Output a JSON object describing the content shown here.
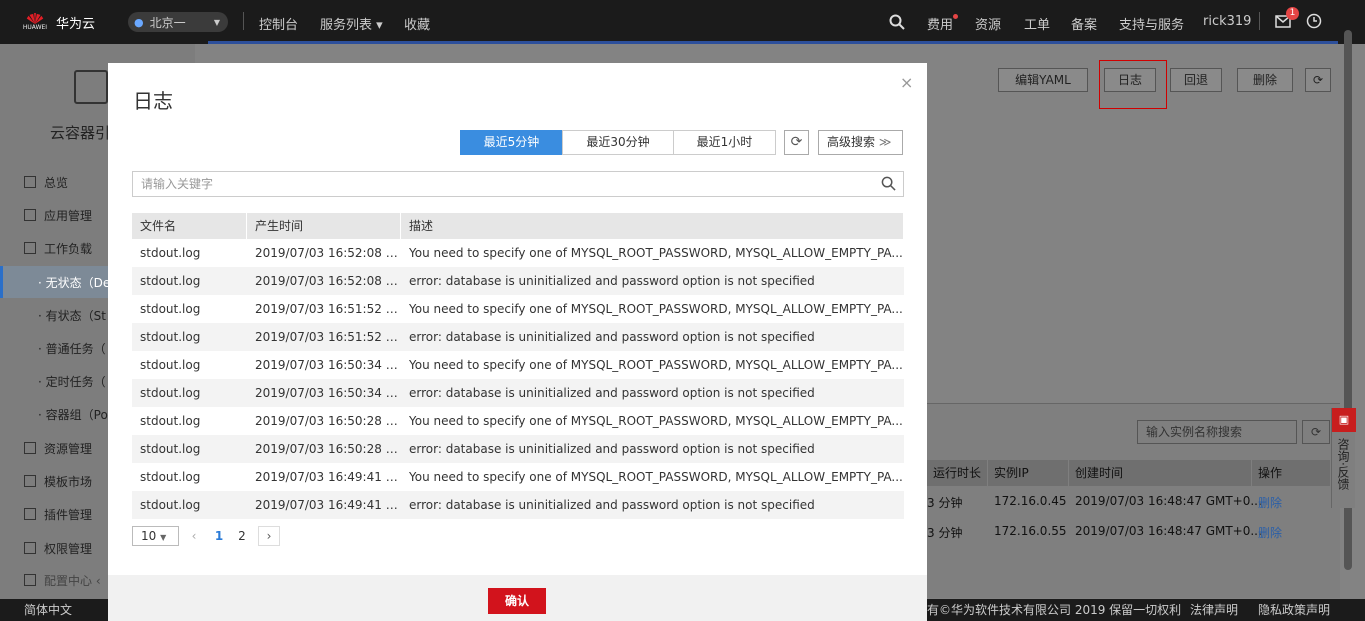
{
  "topbar": {
    "brand": "华为云",
    "brand_sub": "HUAWEI",
    "region": "北京一",
    "nav": [
      "控制台",
      "服务列表",
      "收藏"
    ],
    "right": [
      "费用",
      "资源",
      "工单",
      "备案",
      "支持与服务",
      "rick319"
    ],
    "msg_count": "1"
  },
  "sidebar": {
    "title": "云容器引",
    "items": [
      "总览",
      "应用管理",
      "工作负载"
    ],
    "subitems": [
      "无状态（De",
      "有状态（St",
      "普通任务（",
      "定时任务（",
      "容器组（Po"
    ],
    "items2": [
      "资源管理",
      "模板市场",
      "插件管理",
      "权限管理",
      "配置中心"
    ]
  },
  "background": {
    "buttons": [
      "编辑YAML",
      "日志",
      "回退",
      "删除"
    ],
    "search_placeholder": "输入实例名称搜索",
    "headers": [
      "运行时长",
      "实例IP",
      "创建时间",
      "操作"
    ],
    "rows": [
      {
        "runtime": "3 分钟",
        "ip": "172.16.0.45",
        "created": "2019/07/03 16:48:47 GMT+0...",
        "op": "删除"
      },
      {
        "runtime": "3 分钟",
        "ip": "172.16.0.55",
        "created": "2019/07/03 16:48:47 GMT+0...",
        "op": "删除"
      }
    ]
  },
  "feedback": "咨询·反馈",
  "footer": {
    "lang": "简体中文",
    "copyright": "有©华为软件技术有限公司 2019 保留一切权利",
    "legal": "法律声明",
    "privacy": "隐私政策声明"
  },
  "modal": {
    "title": "日志",
    "close": "×",
    "ranges": [
      "最近5分钟",
      "最近30分钟",
      "最近1小时"
    ],
    "advanced": "高级搜索",
    "search_placeholder": "请输入关键字",
    "headers": [
      "文件名",
      "产生时间",
      "描述"
    ],
    "rows": [
      [
        "stdout.log",
        "2019/07/03 16:52:08 G...",
        "You need to specify one of MYSQL_ROOT_PASSWORD, MYSQL_ALLOW_EMPTY_PA..."
      ],
      [
        "stdout.log",
        "2019/07/03 16:52:08 G...",
        "error: database is uninitialized and password option is not specified"
      ],
      [
        "stdout.log",
        "2019/07/03 16:51:52 G...",
        "You need to specify one of MYSQL_ROOT_PASSWORD, MYSQL_ALLOW_EMPTY_PA..."
      ],
      [
        "stdout.log",
        "2019/07/03 16:51:52 G...",
        "error: database is uninitialized and password option is not specified"
      ],
      [
        "stdout.log",
        "2019/07/03 16:50:34 G...",
        "You need to specify one of MYSQL_ROOT_PASSWORD, MYSQL_ALLOW_EMPTY_PA..."
      ],
      [
        "stdout.log",
        "2019/07/03 16:50:34 G...",
        "error: database is uninitialized and password option is not specified"
      ],
      [
        "stdout.log",
        "2019/07/03 16:50:28 G...",
        "You need to specify one of MYSQL_ROOT_PASSWORD, MYSQL_ALLOW_EMPTY_PA..."
      ],
      [
        "stdout.log",
        "2019/07/03 16:50:28 G...",
        "error: database is uninitialized and password option is not specified"
      ],
      [
        "stdout.log",
        "2019/07/03 16:49:41 G...",
        "You need to specify one of MYSQL_ROOT_PASSWORD, MYSQL_ALLOW_EMPTY_PA..."
      ],
      [
        "stdout.log",
        "2019/07/03 16:49:41 G...",
        "error: database is uninitialized and password option is not specified"
      ]
    ],
    "page_size": "10",
    "pages": [
      "1",
      "2"
    ],
    "confirm": "确认"
  },
  "colors": {
    "accent": "#3a8de0",
    "brand_red": "#d2131c"
  }
}
